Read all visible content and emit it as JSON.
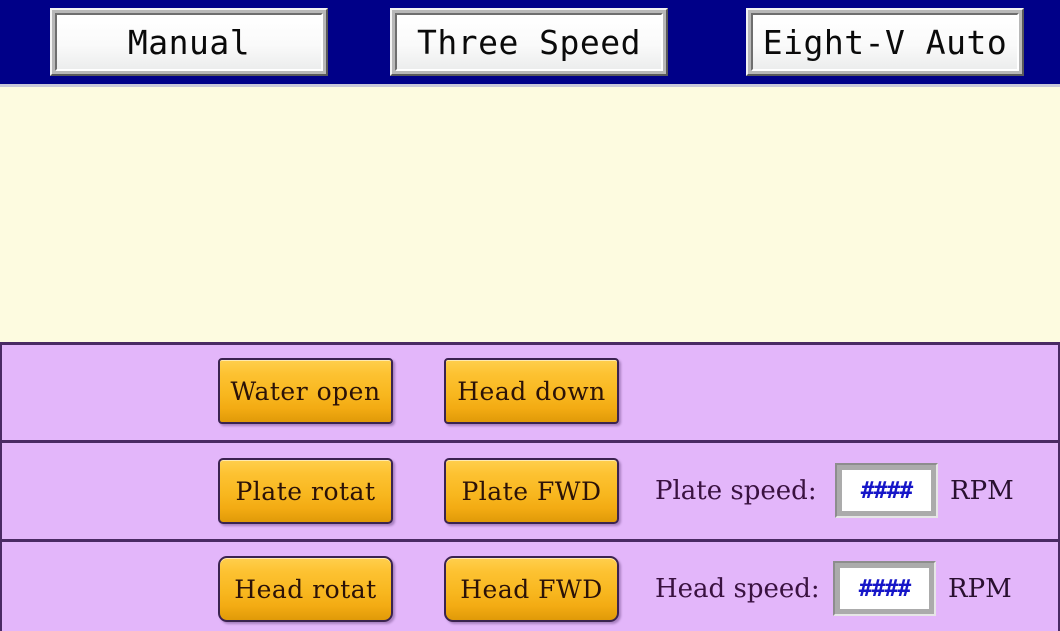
{
  "colors": {
    "topbar_navy": "#000088",
    "panel_cream": "#FDFBE0",
    "row_purple": "#E3B6FA",
    "row_divider": "#4A2A63",
    "button_orange": "#F8B71F",
    "readout_blue": "#1616C8"
  },
  "topbar": {
    "buttons": [
      {
        "label": "Manual"
      },
      {
        "label": "Three Speed"
      },
      {
        "label": "Eight-V Auto"
      }
    ]
  },
  "rows": [
    {
      "name": "water-head-row",
      "buttons": [
        {
          "label": "Water open"
        },
        {
          "label": "Head down"
        }
      ],
      "readout": null
    },
    {
      "name": "plate-row",
      "buttons": [
        {
          "label": "Plate rotat"
        },
        {
          "label": "Plate FWD"
        }
      ],
      "readout": {
        "label": "Plate speed:",
        "value": "####",
        "unit": "RPM"
      }
    },
    {
      "name": "head-row",
      "buttons": [
        {
          "label": "Head rotat"
        },
        {
          "label": "Head FWD"
        }
      ],
      "readout": {
        "label": "Head speed:",
        "value": "####",
        "unit": "RPM"
      }
    }
  ]
}
